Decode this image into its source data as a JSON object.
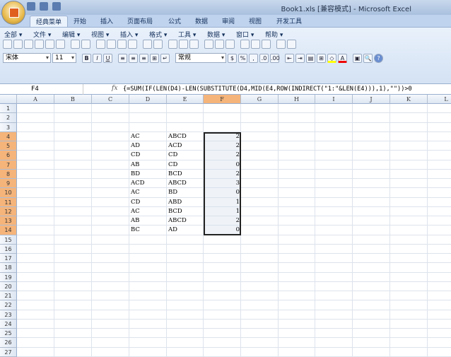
{
  "window": {
    "title": "Book1.xls  [兼容模式] - Microsoft Excel"
  },
  "tabs": [
    "经典菜单",
    "开始",
    "插入",
    "页面布局",
    "公式",
    "数据",
    "审阅",
    "视图",
    "开发工具"
  ],
  "menu": [
    "全部 ▾",
    "文件 ▾",
    "编辑 ▾",
    "视图 ▾",
    "插入 ▾",
    "格式 ▾",
    "工具 ▾",
    "数据 ▾",
    "窗口 ▾",
    "帮助 ▾"
  ],
  "format": {
    "font": "宋体",
    "size": "11",
    "bold": "B",
    "italic": "I",
    "underline": "U",
    "number_format": "常规",
    "percent": "%",
    "comma": ","
  },
  "formula_bar": {
    "name_box": "F4",
    "fx": "fx",
    "formula": "{=SUM(IF(LEN(D4)-LEN(SUBSTITUTE(D4,MID(E4,ROW(INDIRECT(\"1:\"&LEN(E4))),1),\"\"))>0"
  },
  "columns": [
    "A",
    "B",
    "C",
    "D",
    "E",
    "F",
    "G",
    "H",
    "I",
    "J",
    "K",
    "L"
  ],
  "selected_column": "F",
  "rows": 27,
  "data": [
    {
      "row": 4,
      "D": "AC",
      "E": "ABCD",
      "F": "2"
    },
    {
      "row": 5,
      "D": "AD",
      "E": "ACD",
      "F": "2"
    },
    {
      "row": 6,
      "D": "CD",
      "E": "CD",
      "F": "2"
    },
    {
      "row": 7,
      "D": "AB",
      "E": "CD",
      "F": "0"
    },
    {
      "row": 8,
      "D": "BD",
      "E": "BCD",
      "F": "2"
    },
    {
      "row": 9,
      "D": "ACD",
      "E": "ABCD",
      "F": "3"
    },
    {
      "row": 10,
      "D": "AC",
      "E": "BD",
      "F": "0"
    },
    {
      "row": 11,
      "D": "CD",
      "E": "ABD",
      "F": "1"
    },
    {
      "row": 12,
      "D": "AC",
      "E": "BCD",
      "F": "1"
    },
    {
      "row": 13,
      "D": "AB",
      "E": "ABCD",
      "F": "2"
    },
    {
      "row": 14,
      "D": "BC",
      "E": "AD",
      "F": "0"
    }
  ]
}
